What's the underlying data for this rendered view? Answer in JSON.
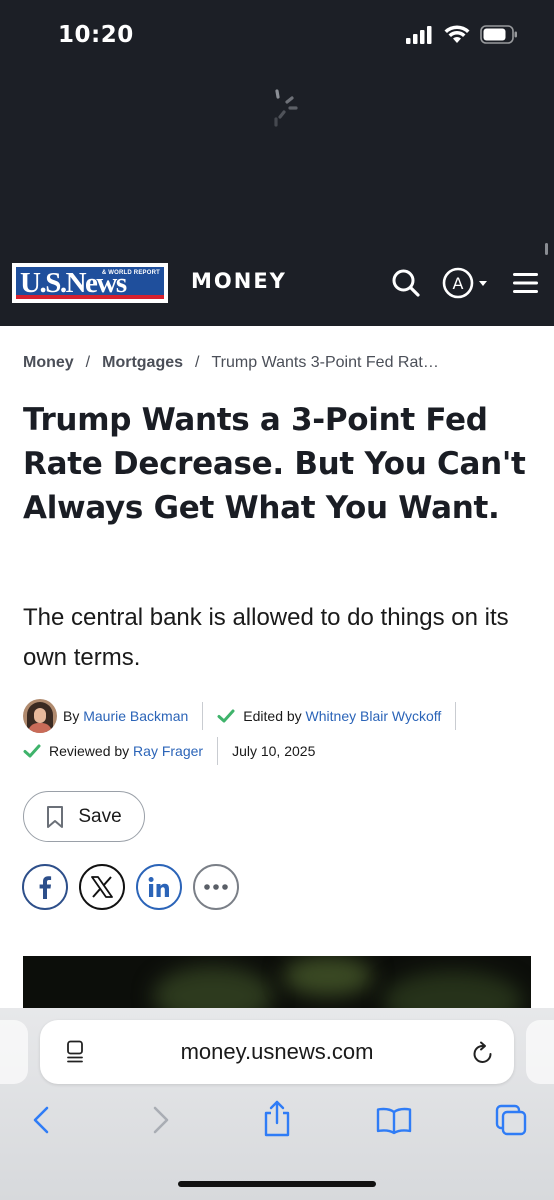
{
  "status": {
    "time": "10:20"
  },
  "header": {
    "logo_text": "U.S.News",
    "logo_sub": "& WORLD REPORT",
    "section": "MONEY",
    "account_initial": "A",
    "colors": {
      "background": "#1c1f26",
      "logo_blue": "#1f4f9c",
      "logo_red": "#d6202e"
    }
  },
  "breadcrumb": {
    "items": [
      "Money",
      "Mortgages"
    ],
    "current": "Trump Wants 3-Point Fed Rat…",
    "separator": "/"
  },
  "article": {
    "headline": "Trump Wants a 3-Point Fed Rate Decrease. But You Can't Always Get What You Want.",
    "dek": "The central bank is allowed to do things on its own terms."
  },
  "byline": {
    "by_prefix": "By",
    "author": "Maurie Backman",
    "edited_prefix": "Edited by",
    "editor": "Whitney Blair Wyckoff",
    "reviewed_prefix": "Reviewed by",
    "reviewer": "Ray Frager",
    "date": "July 10, 2025"
  },
  "actions": {
    "save_label": "Save",
    "share": [
      "facebook-icon",
      "x-icon",
      "linkedin-icon",
      "more-icon"
    ]
  },
  "browser": {
    "url": "money.usnews.com",
    "toolbar": [
      "back-icon",
      "forward-icon",
      "share-icon",
      "bookmarks-icon",
      "tabs-icon"
    ],
    "accent": "#2f7cf6"
  }
}
